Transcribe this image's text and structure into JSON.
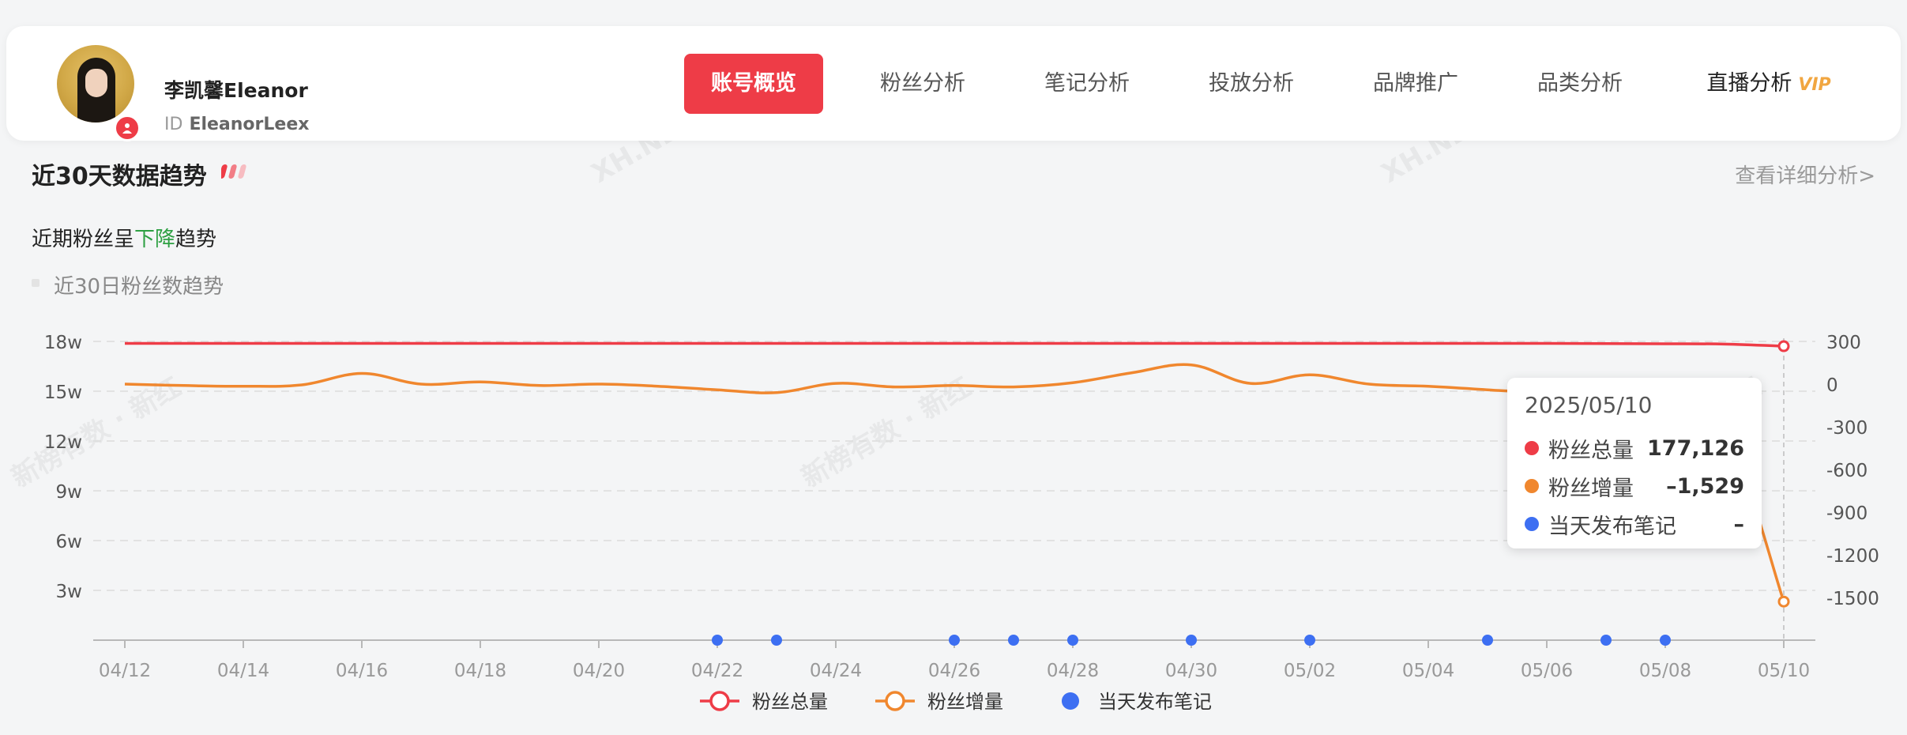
{
  "profile": {
    "name": "李凯馨Eleanor",
    "id_prefix": "ID",
    "id_value": "EleanorLeex"
  },
  "nav": {
    "tabs": [
      {
        "label": "账号概览"
      },
      {
        "label": "粉丝分析"
      },
      {
        "label": "笔记分析"
      },
      {
        "label": "投放分析"
      },
      {
        "label": "品牌推广"
      },
      {
        "label": "品类分析"
      },
      {
        "label": "直播分析"
      }
    ],
    "vip_label": "VIP"
  },
  "section": {
    "title": "近30天数据趋势",
    "detail_link": "查看详细分析>",
    "trend_prefix": "近期粉丝呈",
    "trend_word": "下降",
    "trend_suffix": "趋势",
    "sub_label": "近30日粉丝数趋势"
  },
  "watermarks": {
    "domain": "XH.NEWRANK.CN",
    "brand": "新榜有数 · 新红"
  },
  "tooltip": {
    "date": "2025/05/10",
    "rows": [
      {
        "name": "粉丝总量",
        "value": "177,126"
      },
      {
        "name": "粉丝增量",
        "value": "–1,529"
      },
      {
        "name": "当天发布笔记",
        "value": "–"
      }
    ]
  },
  "colors": {
    "total": "#ee3c47",
    "growth": "#f0872e",
    "notes": "#3d6ff2",
    "active_tab": "#ee3c47",
    "vip": "#f1a640",
    "trend_down": "#2ea043"
  },
  "chart_data": {
    "type": "line",
    "x_tick_labels": [
      "04/12",
      "04/14",
      "04/16",
      "04/18",
      "04/20",
      "04/22",
      "04/24",
      "04/26",
      "04/28",
      "04/30",
      "05/02",
      "05/04",
      "05/06",
      "05/08",
      "05/10"
    ],
    "x": [
      "04/12",
      "04/13",
      "04/14",
      "04/15",
      "04/16",
      "04/17",
      "04/18",
      "04/19",
      "04/20",
      "04/21",
      "04/22",
      "04/23",
      "04/24",
      "04/25",
      "04/26",
      "04/27",
      "04/28",
      "04/29",
      "04/30",
      "05/01",
      "05/02",
      "05/03",
      "05/04",
      "05/05",
      "05/06",
      "05/07",
      "05/08",
      "05/09",
      "05/10"
    ],
    "y_left": {
      "ticks": [
        "18w",
        "15w",
        "12w",
        "9w",
        "6w",
        "3w"
      ],
      "tick_values": [
        180000,
        150000,
        120000,
        90000,
        60000,
        30000
      ],
      "range": [
        0,
        180000
      ]
    },
    "y_right": {
      "ticks": [
        "300",
        "0",
        "-300",
        "-600",
        "-900",
        "-1200",
        "-1500"
      ],
      "tick_values": [
        300,
        0,
        -300,
        -600,
        -900,
        -1200,
        -1500
      ],
      "range": [
        -1800,
        300
      ]
    },
    "series": [
      {
        "name": "粉丝总量",
        "axis": "left",
        "values": [
          178800,
          178800,
          178800,
          178800,
          178800,
          178800,
          178800,
          178800,
          178800,
          178800,
          178800,
          178800,
          178800,
          178800,
          178800,
          178800,
          178800,
          178800,
          178800,
          178800,
          178800,
          178800,
          178800,
          178800,
          178800,
          178700,
          178600,
          178400,
          177126
        ]
      },
      {
        "name": "粉丝增量",
        "axis": "right",
        "values": [
          0,
          -10,
          -15,
          -5,
          75,
          0,
          15,
          -10,
          0,
          -15,
          -40,
          -60,
          5,
          -20,
          -10,
          -20,
          10,
          80,
          135,
          5,
          65,
          0,
          -15,
          -40,
          -70,
          -130,
          -210,
          -320,
          -1529
        ]
      },
      {
        "name": "当天发布笔记",
        "type": "scatter",
        "dates": [
          "04/22",
          "04/23",
          "04/26",
          "04/27",
          "04/28",
          "04/30",
          "05/02",
          "05/05",
          "05/07",
          "05/08"
        ]
      }
    ],
    "legend": [
      "粉丝总量",
      "粉丝增量",
      "当天发布笔记"
    ],
    "legend_position": "bottom-center",
    "grid": true
  }
}
